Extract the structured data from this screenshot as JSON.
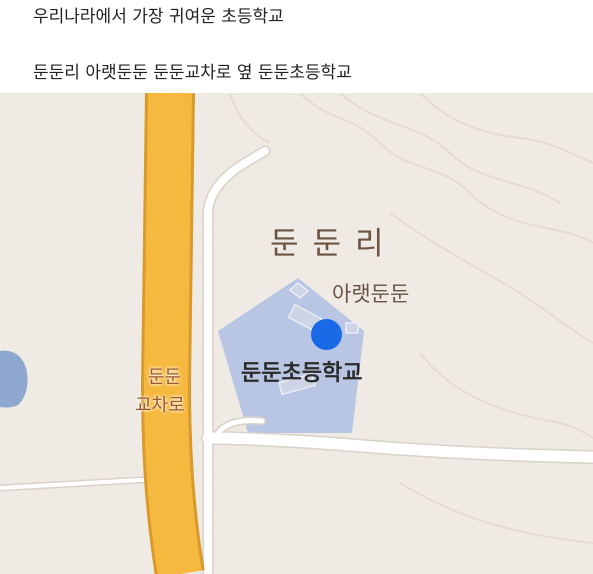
{
  "post": {
    "line1": "우리나라에서 가장 귀여운 초등학교",
    "line2": "둔둔리 아랫둔둔 둔둔교차로 옆 둔둔초등학교"
  },
  "map": {
    "village_label": "둔둔리",
    "hamlet_label": "아랫둔둔",
    "school_label": "둔둔초등학교",
    "interchange_line1": "둔둔",
    "interchange_line2": "교차로",
    "colors": {
      "land": "#efebe4",
      "highway": "#f6b93f",
      "highway_edge": "#d99a2b",
      "school_area": "#b9c6e3",
      "pin": "#1a6ae8",
      "water": "#8ea7cf"
    }
  }
}
